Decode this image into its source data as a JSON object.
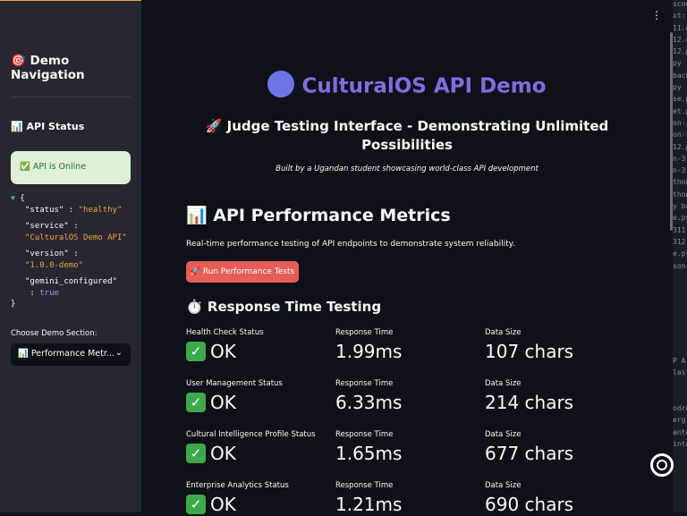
{
  "sidebar": {
    "nav_icon": "🎯",
    "nav_title": "Demo Navigation",
    "api_status_icon": "📊",
    "api_status_title": "API Status",
    "online_icon": "✅",
    "online_text": "API is Online",
    "json": [
      {
        "key": "\"status\"",
        "value": "\"healthy\"",
        "type": "string"
      },
      {
        "key": "\"service\"",
        "value": "\"CulturalOS Demo API\"",
        "type": "string"
      },
      {
        "key": "\"version\"",
        "value": "\"1.0.0-demo\"",
        "type": "string"
      },
      {
        "key": "\"gemini_configured\"",
        "value": "true",
        "type": "bool"
      }
    ],
    "choose_label": "Choose Demo Section:",
    "select_icon": "📊",
    "select_value": "Performance Metr..."
  },
  "main": {
    "hero_title": "CulturalOS API Demo",
    "subtitle": "🚀 Judge Testing Interface - Demonstrating Unlimited Possibilities",
    "byline": "Built by a Ugandan student showcasing world-class API development",
    "section_icon": "📊",
    "section_title": "API Performance Metrics",
    "description": "Real-time performance testing of API endpoints to demonstrate system reliability.",
    "run_button": "🚀 Run Performance Tests",
    "subsection_icon": "⏱️",
    "subsection_title": "Response Time Testing",
    "rows": [
      {
        "status_label": "Health Check Status",
        "status": "OK",
        "time_label": "Response Time",
        "time": "1.99ms",
        "size_label": "Data Size",
        "size": "107 chars"
      },
      {
        "status_label": "User Management Status",
        "status": "OK",
        "time_label": "Response Time",
        "time": "6.33ms",
        "size_label": "Data Size",
        "size": "214 chars"
      },
      {
        "status_label": "Cultural Intelligence Profile Status",
        "status": "OK",
        "time_label": "Response Time",
        "time": "1.65ms",
        "size_label": "Data Size",
        "size": "677 chars"
      },
      {
        "status_label": "Enterprise Analytics Status",
        "status": "OK",
        "time_label": "Response Time",
        "time": "1.21ms",
        "size_label": "Data Size",
        "size": "690 chars"
      }
    ]
  },
  "background_window_fragments": [
    "scod",
    "xt: (s",
    "11.e",
    "12.e",
    "12.p",
    "py",
    "back",
    "py",
    "se.p",
    "et.p",
    "on-3",
    "on-3",
    "12.p",
    "n-31",
    "n-31",
    "thon",
    "thon",
    "y ba",
    "e.py",
    "311",
    "312",
    "e.py",
    "son",
    "",
    "",
    "",
    "",
    "",
    "",
    "",
    "P A",
    "last",
    "",
    "",
    "odre",
    "ergra",
    "ante",
    "inte"
  ],
  "colors": {
    "background": "#0e1117",
    "sidebar": "#262730",
    "hero": "#7c6fe0",
    "run_button": "#e55e58",
    "online_box": "#dff0d8",
    "success_check": "#3ea84a"
  }
}
